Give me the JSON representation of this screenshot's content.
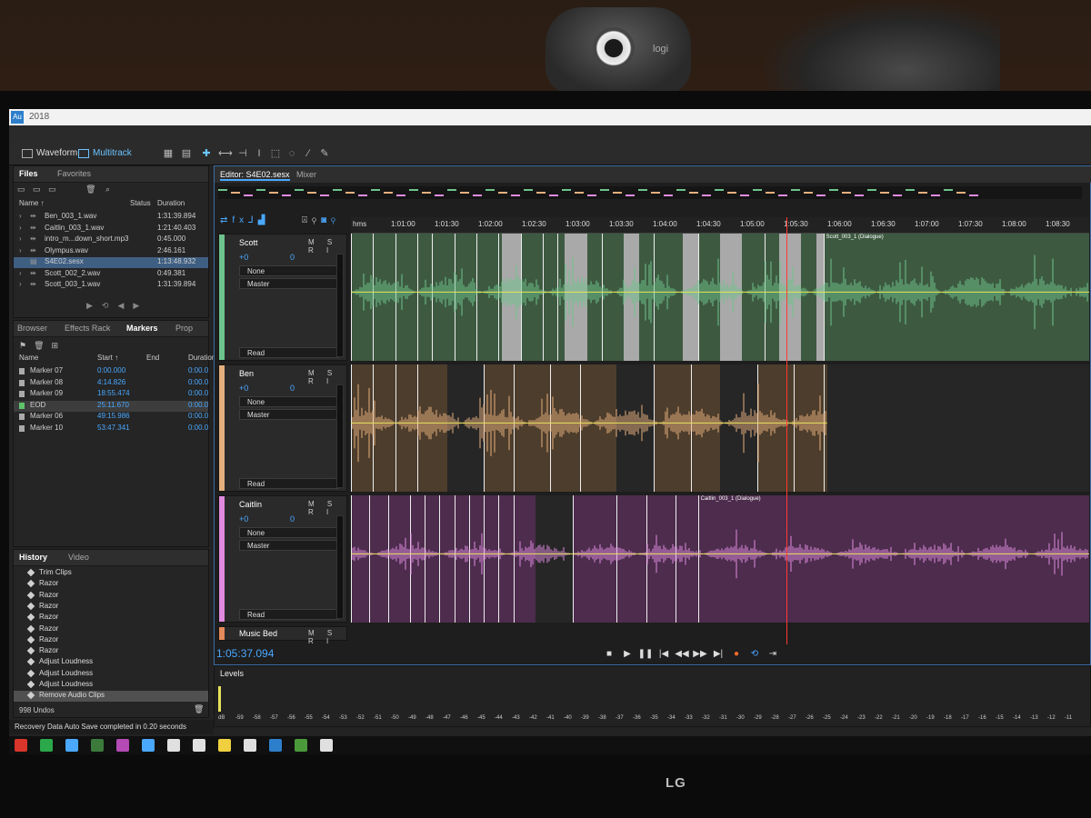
{
  "app": {
    "title_icon": "Au",
    "window_title": "2018"
  },
  "modes": {
    "waveform": "Waveform",
    "multitrack": "Multitrack"
  },
  "files": {
    "tabs": [
      "Files",
      "Favorites"
    ],
    "columns": {
      "name": "Name ↑",
      "status": "Status",
      "duration": "Duration"
    },
    "items": [
      {
        "name": "Ben_003_1.wav",
        "duration": "1:31:39.894"
      },
      {
        "name": "Caitlin_003_1.wav",
        "duration": "1:21:40.403"
      },
      {
        "name": "intro_m...down_short.mp3",
        "duration": "0:45.000"
      },
      {
        "name": "Olympus.wav",
        "duration": "2:46.161"
      },
      {
        "name": "S4E02.sesx",
        "duration": "1:13:48.932"
      },
      {
        "name": "Scott_002_2.wav",
        "duration": "0:49.381"
      },
      {
        "name": "Scott_003_1.wav",
        "duration": "1:31:39.894"
      }
    ]
  },
  "markers": {
    "tabs": [
      "Browser",
      "Effects Rack",
      "Markers",
      "Prop"
    ],
    "columns": {
      "name": "Name",
      "start": "Start ↑",
      "end": "End",
      "duration": "Duration"
    },
    "items": [
      {
        "name": "Marker 07",
        "start": "0:00.000",
        "duration": "0:00.0"
      },
      {
        "name": "Marker 08",
        "start": "4:14.826",
        "duration": "0:00.0"
      },
      {
        "name": "Marker 09",
        "start": "18:55.474",
        "duration": "0:00.0"
      },
      {
        "name": "EOD",
        "start": "25:11.670",
        "duration": "0:00.0"
      },
      {
        "name": "Marker 06",
        "start": "49:15.986",
        "duration": "0:00.0"
      },
      {
        "name": "Marker 10",
        "start": "53:47.341",
        "duration": "0:00.0"
      }
    ]
  },
  "history": {
    "tabs": [
      "History",
      "Video"
    ],
    "items": [
      "Trim Clips",
      "Razor",
      "Razor",
      "Razor",
      "Razor",
      "Razor",
      "Razor",
      "Razor",
      "Adjust Loudness",
      "Adjust Loudness",
      "Adjust Loudness",
      "Remove Audio Clips"
    ],
    "undos": "998 Undos"
  },
  "status": {
    "message": "Recovery Data Auto Save completed in 0.20 seconds"
  },
  "editor": {
    "tab": "Editor: S4E02.sesx",
    "mixer": "Mixer",
    "ruler_unit": "hms",
    "ticks": [
      "1:01:00",
      "1:01:30",
      "1:02:00",
      "1:02:30",
      "1:03:00",
      "1:03:30",
      "1:04:00",
      "1:04:30",
      "1:05:00",
      "1:05:30",
      "1:06:00",
      "1:06:30",
      "1:07:00",
      "1:07:30",
      "1:08:00",
      "1:08:30"
    ],
    "timecode": "1:05:37.094",
    "tracks": [
      {
        "name": "Scott",
        "color": "#6ec38c",
        "lane": "#3d5a41",
        "vol": "+0",
        "pan": "0",
        "input": "None",
        "output": "Master",
        "mode": "Read",
        "clip_label": "Scott_003_1 (Dialogue)",
        "short": "Scot"
      },
      {
        "name": "Ben",
        "color": "#e5b07d",
        "lane": "#4d3d2c",
        "vol": "+0",
        "pan": "0",
        "input": "None",
        "output": "Master",
        "mode": "Read",
        "clip_label": "",
        "short": "Ben"
      },
      {
        "name": "Caitlin",
        "color": "#e08be0",
        "lane": "#4d2c4d",
        "vol": "+0",
        "pan": "0",
        "input": "None",
        "output": "Master",
        "mode": "Read",
        "clip_label": "Caitlin_003_1 (Dialogue)",
        "short": "Caitli"
      }
    ],
    "music_bed": "Music Bed",
    "track_buttons": "M S R I"
  },
  "levels": {
    "title": "Levels",
    "scale": [
      "dB",
      "-59",
      "-58",
      "-57",
      "-56",
      "-55",
      "-54",
      "-53",
      "-52",
      "-51",
      "-50",
      "-49",
      "-48",
      "-47",
      "-46",
      "-45",
      "-44",
      "-43",
      "-42",
      "-41",
      "-40",
      "-39",
      "-38",
      "-37",
      "-36",
      "-35",
      "-34",
      "-33",
      "-32",
      "-31",
      "-30",
      "-29",
      "-28",
      "-27",
      "-26",
      "-25",
      "-24",
      "-23",
      "-22",
      "-21",
      "-20",
      "-19",
      "-18",
      "-17",
      "-16",
      "-15",
      "-14",
      "-13",
      "-12",
      "-11"
    ]
  },
  "monitor": {
    "brand": "LG",
    "webcam_brand": "logi"
  }
}
